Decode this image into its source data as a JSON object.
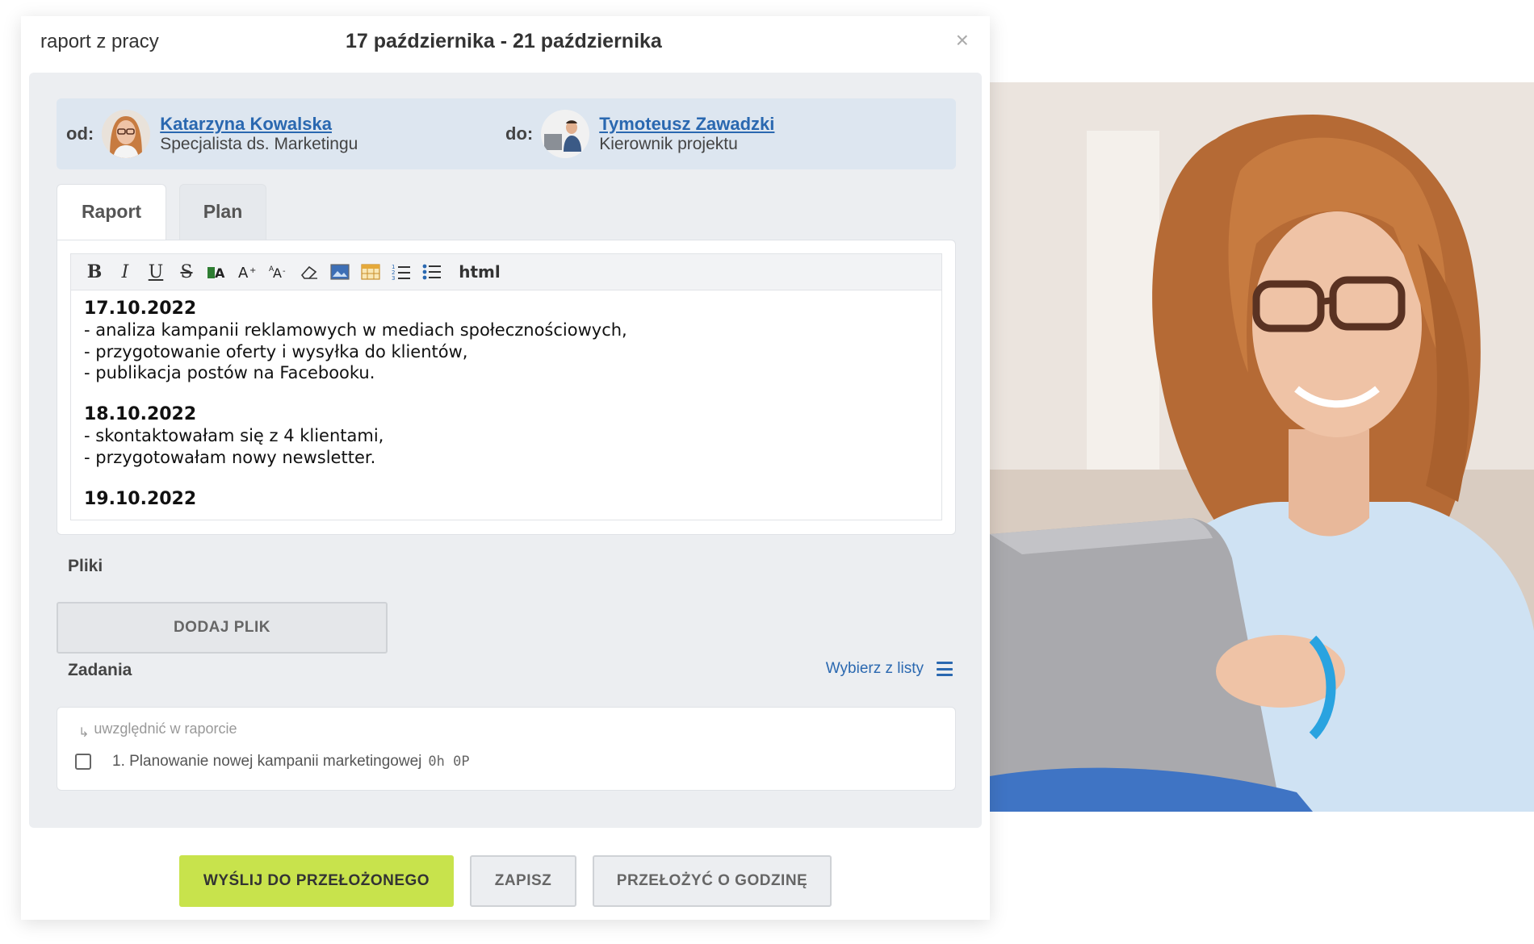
{
  "dialog": {
    "kind": "raport z pracy",
    "range": "17 października - 21 października",
    "close": "×"
  },
  "people": {
    "from": {
      "label": "od:",
      "name": "Katarzyna Kowalska",
      "role": "Specjalista ds. Marketingu"
    },
    "to": {
      "label": "do:",
      "name": "Tymoteusz Zawadzki",
      "role": "Kierownik projektu"
    }
  },
  "tabs": [
    {
      "label": "Raport",
      "active": true
    },
    {
      "label": "Plan",
      "active": false
    }
  ],
  "toolbar": {
    "bold": "B",
    "italic": "I",
    "underline": "U",
    "strike": "S",
    "html": "html",
    "icons": [
      "font-color-icon",
      "font-size-increase-icon",
      "font-size-decrease-icon",
      "eraser-icon",
      "image-icon",
      "table-icon",
      "ordered-list-icon",
      "unordered-list-icon"
    ]
  },
  "editor": {
    "days": [
      {
        "date": "17.10.2022",
        "lines": [
          "- analiza kampanii reklamowych w mediach społecznościowych,",
          "- przygotowanie oferty i wysyłka do klientów,",
          "- publikacja postów na Facebooku."
        ]
      },
      {
        "date": "18.10.2022",
        "lines": [
          "- skontaktowałam się z 4 klientami,",
          "- przygotowałam nowy newsletter."
        ]
      },
      {
        "date": "19.10.2022",
        "lines": []
      }
    ]
  },
  "files": {
    "label": "Pliki",
    "add_button": "DODAJ PLIK"
  },
  "tasks": {
    "label": "Zadania",
    "choose": "Wybierz z listy",
    "include_hint": "uwzględnić w raporcie",
    "items": [
      {
        "name": "1. Planowanie nowej kampanii marketingowej",
        "meta": "0h 0P"
      }
    ]
  },
  "actions": {
    "send": "WYŚLIJ DO PRZEŁOŻONEGO",
    "save": "ZAPISZ",
    "postpone": "PRZEŁOŻYĆ O GODZINĘ"
  },
  "colors": {
    "accent_green": "#c8e34c",
    "link_blue": "#2a68b0",
    "panel_gray": "#eceef1",
    "people_bg": "#dde6f0"
  }
}
